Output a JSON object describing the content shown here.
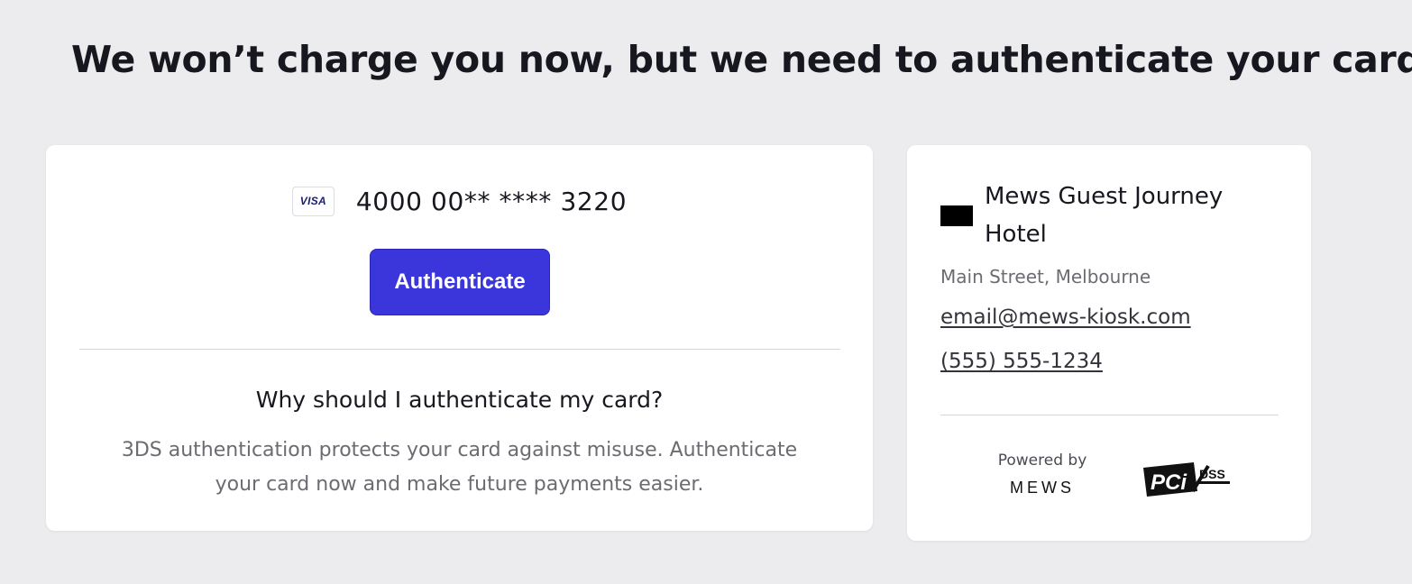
{
  "page": {
    "title": "We won’t charge you now, but we need to authenticate your card"
  },
  "payment_card": {
    "brand": "VISA",
    "brand_icon": "visa-card-icon",
    "number_masked": "4000 00** **** 3220",
    "authenticate_label": "Authenticate",
    "why_title": "Why should I authenticate my card?",
    "why_text": "3DS authentication protects your card against misuse. Authenticate your card now and make future payments easier."
  },
  "hotel": {
    "name": "Mews Guest Journey Hotel",
    "address": "Main Street, Melbourne",
    "email": "email@mews-kiosk.com",
    "phone": "(555) 555-1234",
    "logo_icon": "hotel-logo-icon"
  },
  "footer": {
    "powered_by": "Powered by",
    "brand_wordmark": "MEWS",
    "pci_icon": "pci-dss-compliant-icon",
    "pci_text": "DSS"
  },
  "colors": {
    "background": "#ececee",
    "card": "#ffffff",
    "accent": "#3b36db",
    "text_primary": "#17171f",
    "text_muted": "#6b6b72"
  }
}
